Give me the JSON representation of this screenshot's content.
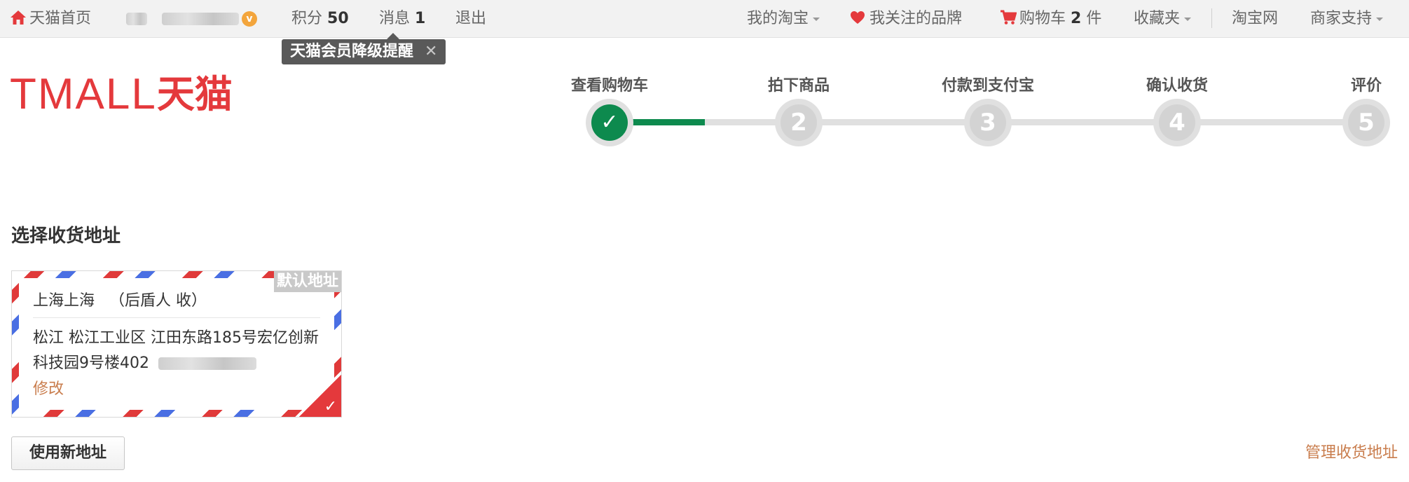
{
  "topbar": {
    "home": "天猫首页",
    "points_label": "积分",
    "points_value": "50",
    "messages_label": "消息",
    "messages_count": "1",
    "logout": "退出",
    "my_taobao": "我的淘宝",
    "followed_brands": "我关注的品牌",
    "cart_label": "购物车",
    "cart_count": "2",
    "cart_unit": "件",
    "favorites": "收藏夹",
    "taobao": "淘宝网",
    "merchant_support": "商家支持"
  },
  "tooltip": {
    "text": "天猫会员降级提醒",
    "close": "✕"
  },
  "logo": {
    "latin": "TMALL",
    "cjk": "天猫"
  },
  "steps": [
    {
      "label": "查看购物车",
      "marker": "✓"
    },
    {
      "label": "拍下商品",
      "marker": "2"
    },
    {
      "label": "付款到支付宝",
      "marker": "3"
    },
    {
      "label": "确认收货",
      "marker": "4"
    },
    {
      "label": "评价",
      "marker": "5"
    }
  ],
  "address": {
    "section_title": "选择收货地址",
    "default_tag": "默认地址",
    "name_line": "上海上海   （后盾人 收）",
    "detail": "松江 松江工业区  江田东路185号宏亿创新科技园9号楼402",
    "edit": "修改",
    "selected_mark": "✓"
  },
  "actions": {
    "new_address": "使用新地址",
    "manage_address": "管理收货地址"
  },
  "colors": {
    "brand_red": "#e4393c",
    "step_done": "#0d8a4e",
    "link_orange": "#c97d4d"
  }
}
